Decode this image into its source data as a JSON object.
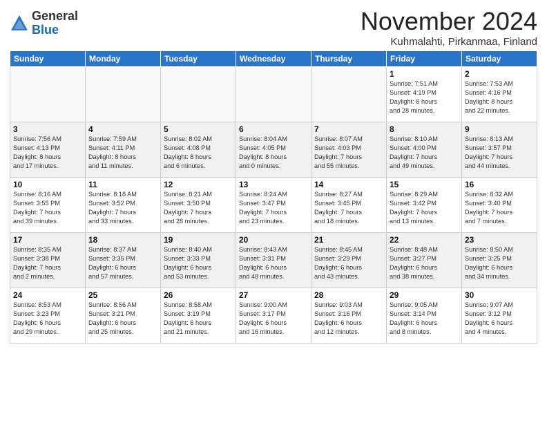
{
  "logo": {
    "general": "General",
    "blue": "Blue"
  },
  "header": {
    "month": "November 2024",
    "location": "Kuhmalahti, Pirkanmaa, Finland"
  },
  "weekdays": [
    "Sunday",
    "Monday",
    "Tuesday",
    "Wednesday",
    "Thursday",
    "Friday",
    "Saturday"
  ],
  "weeks": [
    [
      {
        "day": "",
        "info": ""
      },
      {
        "day": "",
        "info": ""
      },
      {
        "day": "",
        "info": ""
      },
      {
        "day": "",
        "info": ""
      },
      {
        "day": "",
        "info": ""
      },
      {
        "day": "1",
        "info": "Sunrise: 7:51 AM\nSunset: 4:19 PM\nDaylight: 8 hours\nand 28 minutes."
      },
      {
        "day": "2",
        "info": "Sunrise: 7:53 AM\nSunset: 4:16 PM\nDaylight: 8 hours\nand 22 minutes."
      }
    ],
    [
      {
        "day": "3",
        "info": "Sunrise: 7:56 AM\nSunset: 4:13 PM\nDaylight: 8 hours\nand 17 minutes."
      },
      {
        "day": "4",
        "info": "Sunrise: 7:59 AM\nSunset: 4:11 PM\nDaylight: 8 hours\nand 11 minutes."
      },
      {
        "day": "5",
        "info": "Sunrise: 8:02 AM\nSunset: 4:08 PM\nDaylight: 8 hours\nand 6 minutes."
      },
      {
        "day": "6",
        "info": "Sunrise: 8:04 AM\nSunset: 4:05 PM\nDaylight: 8 hours\nand 0 minutes."
      },
      {
        "day": "7",
        "info": "Sunrise: 8:07 AM\nSunset: 4:03 PM\nDaylight: 7 hours\nand 55 minutes."
      },
      {
        "day": "8",
        "info": "Sunrise: 8:10 AM\nSunset: 4:00 PM\nDaylight: 7 hours\nand 49 minutes."
      },
      {
        "day": "9",
        "info": "Sunrise: 8:13 AM\nSunset: 3:57 PM\nDaylight: 7 hours\nand 44 minutes."
      }
    ],
    [
      {
        "day": "10",
        "info": "Sunrise: 8:16 AM\nSunset: 3:55 PM\nDaylight: 7 hours\nand 39 minutes."
      },
      {
        "day": "11",
        "info": "Sunrise: 8:18 AM\nSunset: 3:52 PM\nDaylight: 7 hours\nand 33 minutes."
      },
      {
        "day": "12",
        "info": "Sunrise: 8:21 AM\nSunset: 3:50 PM\nDaylight: 7 hours\nand 28 minutes."
      },
      {
        "day": "13",
        "info": "Sunrise: 8:24 AM\nSunset: 3:47 PM\nDaylight: 7 hours\nand 23 minutes."
      },
      {
        "day": "14",
        "info": "Sunrise: 8:27 AM\nSunset: 3:45 PM\nDaylight: 7 hours\nand 18 minutes."
      },
      {
        "day": "15",
        "info": "Sunrise: 8:29 AM\nSunset: 3:42 PM\nDaylight: 7 hours\nand 13 minutes."
      },
      {
        "day": "16",
        "info": "Sunrise: 8:32 AM\nSunset: 3:40 PM\nDaylight: 7 hours\nand 7 minutes."
      }
    ],
    [
      {
        "day": "17",
        "info": "Sunrise: 8:35 AM\nSunset: 3:38 PM\nDaylight: 7 hours\nand 2 minutes."
      },
      {
        "day": "18",
        "info": "Sunrise: 8:37 AM\nSunset: 3:35 PM\nDaylight: 6 hours\nand 57 minutes."
      },
      {
        "day": "19",
        "info": "Sunrise: 8:40 AM\nSunset: 3:33 PM\nDaylight: 6 hours\nand 53 minutes."
      },
      {
        "day": "20",
        "info": "Sunrise: 8:43 AM\nSunset: 3:31 PM\nDaylight: 6 hours\nand 48 minutes."
      },
      {
        "day": "21",
        "info": "Sunrise: 8:45 AM\nSunset: 3:29 PM\nDaylight: 6 hours\nand 43 minutes."
      },
      {
        "day": "22",
        "info": "Sunrise: 8:48 AM\nSunset: 3:27 PM\nDaylight: 6 hours\nand 38 minutes."
      },
      {
        "day": "23",
        "info": "Sunrise: 8:50 AM\nSunset: 3:25 PM\nDaylight: 6 hours\nand 34 minutes."
      }
    ],
    [
      {
        "day": "24",
        "info": "Sunrise: 8:53 AM\nSunset: 3:23 PM\nDaylight: 6 hours\nand 29 minutes."
      },
      {
        "day": "25",
        "info": "Sunrise: 8:56 AM\nSunset: 3:21 PM\nDaylight: 6 hours\nand 25 minutes."
      },
      {
        "day": "26",
        "info": "Sunrise: 8:58 AM\nSunset: 3:19 PM\nDaylight: 6 hours\nand 21 minutes."
      },
      {
        "day": "27",
        "info": "Sunrise: 9:00 AM\nSunset: 3:17 PM\nDaylight: 6 hours\nand 16 minutes."
      },
      {
        "day": "28",
        "info": "Sunrise: 9:03 AM\nSunset: 3:16 PM\nDaylight: 6 hours\nand 12 minutes."
      },
      {
        "day": "29",
        "info": "Sunrise: 9:05 AM\nSunset: 3:14 PM\nDaylight: 6 hours\nand 8 minutes."
      },
      {
        "day": "30",
        "info": "Sunrise: 9:07 AM\nSunset: 3:12 PM\nDaylight: 6 hours\nand 4 minutes."
      }
    ]
  ]
}
